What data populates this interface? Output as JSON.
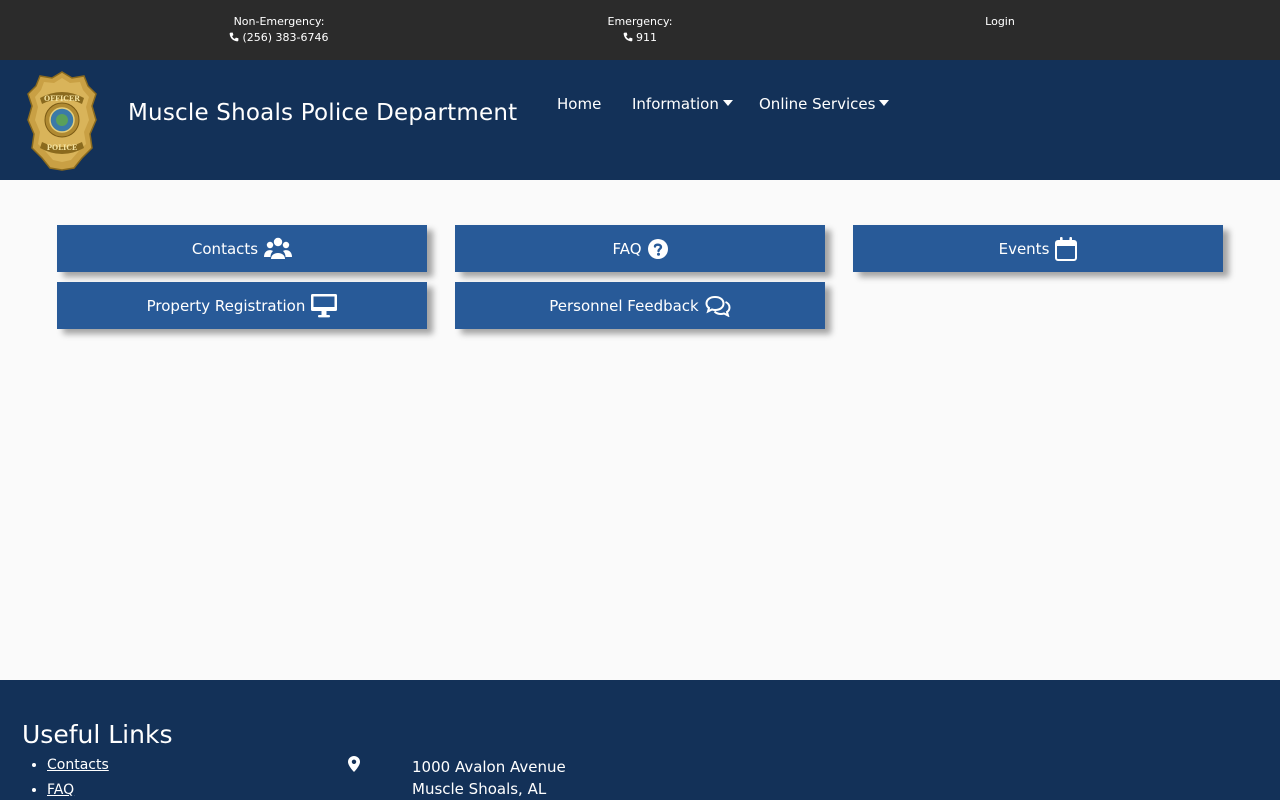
{
  "topbar": {
    "non_emergency_label": "Non-Emergency:",
    "non_emergency_phone": "(256) 383-6746",
    "emergency_label": "Emergency:",
    "emergency_phone": "911",
    "login": "Login"
  },
  "header": {
    "title": "Muscle Shoals Police Department",
    "badge_top_text": "OFFICER",
    "badge_bottom_text": "POLICE",
    "nav": {
      "home": "Home",
      "information": "Information",
      "online_services": "Online Services"
    }
  },
  "buttons": {
    "contacts": "Contacts",
    "faq": "FAQ",
    "events": "Events",
    "property_registration": "Property Registration",
    "personnel_feedback": "Personnel Feedback"
  },
  "footer": {
    "heading": "Useful Links",
    "links": [
      "Contacts",
      "FAQ"
    ],
    "address_line1": "1000 Avalon Avenue",
    "address_line2": "Muscle Shoals, AL"
  },
  "colors": {
    "topbar": "#2b2b2b",
    "header": "#133158",
    "button": "#285a98",
    "page": "#fafafa"
  }
}
